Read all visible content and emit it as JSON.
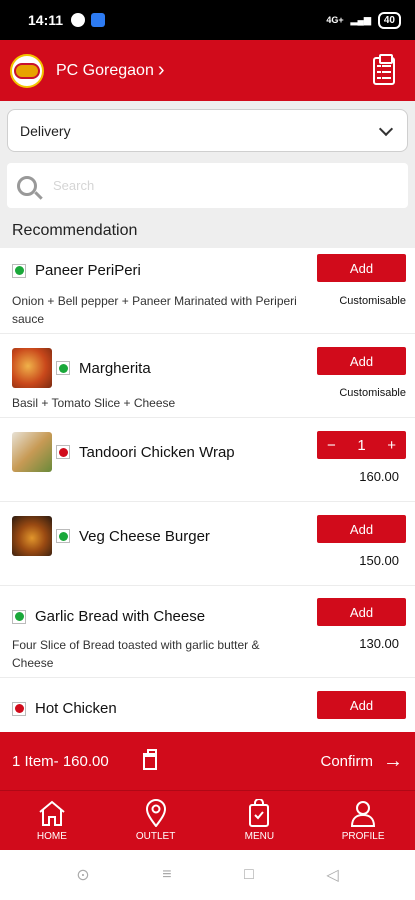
{
  "status_bar": {
    "time": "14:11",
    "battery": "40",
    "network": "4G+"
  },
  "header": {
    "outlet": "PC Goregaon",
    "chevron": "›"
  },
  "order_type": {
    "selected": "Delivery"
  },
  "search": {
    "placeholder": "Search"
  },
  "section_title": "Recommendation",
  "items": [
    {
      "name": "Paneer PeriPeri",
      "desc": "Onion + Bell pepper + Paneer Marinated with Periperi sauce",
      "veg": true,
      "action": "Add",
      "note": "Customisable",
      "thumb": false
    },
    {
      "name": "Margherita",
      "desc": "Basil + Tomato Slice + Cheese",
      "veg": true,
      "action": "Add",
      "note": "Customisable",
      "thumb": true
    },
    {
      "name": "Tandoori Chicken Wrap",
      "desc": "",
      "veg": false,
      "quantity": "1",
      "minus": "−",
      "plus": "+",
      "price": "160.00",
      "thumb": true
    },
    {
      "name": "Veg Cheese Burger",
      "desc": "",
      "veg": true,
      "action": "Add",
      "price": "150.00",
      "thumb": true
    },
    {
      "name": "Garlic Bread with Cheese",
      "desc": "Four Slice of Bread toasted with garlic butter & Cheese",
      "veg": true,
      "action": "Add",
      "price": "130.00",
      "thumb": false
    },
    {
      "name": "Hot Chicken",
      "desc": "",
      "veg": false,
      "action": "Add",
      "thumb": false
    }
  ],
  "cart": {
    "summary": "1 Item- 160.00",
    "confirm": "Confirm",
    "arrow": "→"
  },
  "nav": [
    {
      "label": "HOME",
      "icon": "home-icon"
    },
    {
      "label": "OUTLET",
      "icon": "location-pin-icon"
    },
    {
      "label": "MENU",
      "icon": "menu-bag-icon"
    },
    {
      "label": "PROFILE",
      "icon": "profile-icon"
    }
  ],
  "colors": {
    "brand_red": "#d10b1b",
    "veg_green": "#1aa83a",
    "nonveg_red": "#d10b1b"
  }
}
